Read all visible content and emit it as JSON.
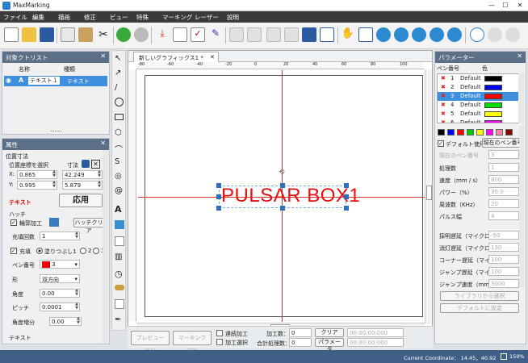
{
  "window": {
    "title": "MaxMarking",
    "min": "—",
    "max": "☐",
    "close": "✕"
  },
  "menu": [
    "ファイル",
    "編集",
    "描画",
    "修正",
    "ビュー",
    "特殊",
    "マーキング",
    "レーザー",
    "説明"
  ],
  "object_list": {
    "title": "対象クトリスト",
    "col_name": "名称",
    "col_type": "種類",
    "row": {
      "name": "テキスト１",
      "type": "テキスト"
    }
  },
  "properties": {
    "title": "属性",
    "pos_size": "位置寸法",
    "select_pos": "位置座標を選択",
    "size": "寸法",
    "x_label": "X:",
    "x_val": "0.865",
    "y_label": "Y:",
    "y_val": "0.995",
    "w_val": "42.249",
    "h_val": "5.879",
    "text_label": "テキスト",
    "apply": "応用",
    "hatch": "ハッチ",
    "outline": "輪郭加工",
    "hatch_clear": "ハッチクリア",
    "fill_count_label": "充填回数",
    "fill_count": "1",
    "fill_label": "充填",
    "fill_opt1": "塗りつぶし1",
    "fill_opt2": "2",
    "fill_opt3": "3",
    "pen_label": "ペン番号",
    "pen_val": "3",
    "shape_label": "形",
    "shape_val": "双方向",
    "angle_label": "角度",
    "angle_val": "0.00",
    "pitch_label": "ピッチ",
    "pitch_val": "0.0001",
    "angle_inc_label": "角度増分",
    "angle_inc_val": "0.00",
    "text_section": "テキスト"
  },
  "canvas": {
    "tab": "新しいグラフィックス1 *",
    "tab_close": "✕",
    "text": "PULSAR BOX1",
    "ruler_marks": [
      "-80",
      "-60",
      "-40",
      "-20",
      "0",
      "20",
      "40",
      "60",
      "80",
      "100"
    ]
  },
  "bottom": {
    "preview": "プレビュー(F1)",
    "marking": "マーキング(F2)",
    "continuous": "連続加工",
    "selected": "加工選択",
    "count_label": "加工数：",
    "count_val": "0",
    "total_label": "合計処理数：",
    "total_val": "0",
    "clear": "クリア",
    "params": "パラメータ",
    "time1": "00:00:00:000",
    "time2": "00:00:00:000"
  },
  "parameters": {
    "title": "パラメーター",
    "col_pen": "ペン番号",
    "col_color": "色",
    "pens": [
      {
        "no": "1",
        "name": "Default",
        "color": "#000000"
      },
      {
        "no": "2",
        "name": "Default",
        "color": "#0000ff"
      },
      {
        "no": "3",
        "name": "Default",
        "color": "#ff0000"
      },
      {
        "no": "4",
        "name": "Default",
        "color": "#00dd00"
      },
      {
        "no": "5",
        "name": "Default",
        "color": "#ffff00"
      },
      {
        "no": "6",
        "name": "Default",
        "color": "#ff00ff"
      }
    ],
    "palette": [
      "#000000",
      "#0000ff",
      "#ff0000",
      "#00cc00",
      "#ffff00",
      "#ff00ff",
      "#ff88aa",
      "#8b0000"
    ],
    "use_default": "デフォルト使用",
    "current_pen_btn": "現在のペン番号",
    "current_pen_label": "現在のペン番号",
    "current_pen_val": "3",
    "rows": [
      {
        "label": "処理数",
        "val": "1"
      },
      {
        "label": "速度（mm / s）",
        "val": "800"
      },
      {
        "label": "パワー（%）",
        "val": "30.0"
      },
      {
        "label": "周波数（KHz）",
        "val": "20"
      },
      {
        "label": "パルス幅",
        "val": "4"
      }
    ],
    "rows2": [
      {
        "label": "採明遅延（マイクロ",
        "val": "-50"
      },
      {
        "label": "消灯遅延（マイクロ",
        "val": "130"
      },
      {
        "label": "コーナー遅延（マイク",
        "val": "100"
      },
      {
        "label": "ジャンプ遅延（マイク",
        "val": "100"
      },
      {
        "label": "ジャンプ速度（mm",
        "val": "3000"
      }
    ],
    "select_from_lib": "ライブラリから選択",
    "set_default": "デフォルトに設定"
  },
  "status": {
    "coord": "Current Coordinate： 14.45，40.92",
    "zoom": "159%"
  }
}
